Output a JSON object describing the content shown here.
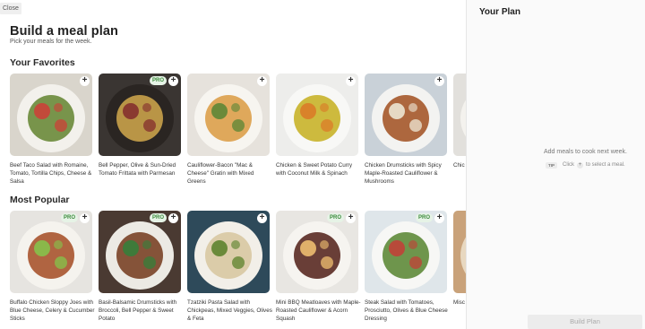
{
  "close_label": "Close",
  "header": {
    "title": "Build a meal plan",
    "subtitle": "Pick your meals for the week."
  },
  "sections": [
    {
      "title": "Your Favorites",
      "meals": [
        {
          "name": "Beef Taco Salad with Romaine, Tomato, Tortilla Chips, Cheese & Salsa",
          "pro": false,
          "bg": "#d9d5cc",
          "plate": "#f3f1ec",
          "food": "#6a8a3a",
          "food2": "#c24a3a"
        },
        {
          "name": "Bell Pepper, Olive & Sun-Dried Tomato Frittata with Parmesan",
          "pro": true,
          "bg": "#3a3532",
          "plate": "#2a2522",
          "food": "#c9a24a",
          "food2": "#8a3a30"
        },
        {
          "name": "Cauliflower-Bacon \"Mac & Cheese\" Gratin with Mixed Greens",
          "pro": false,
          "bg": "#e6e2dc",
          "plate": "#f7f5f0",
          "food": "#dba04a",
          "food2": "#6a8a3a"
        },
        {
          "name": "Chicken & Sweet Potato Curry with Coconut Milk & Spinach",
          "pro": false,
          "bg": "#ededeb",
          "plate": "#f8f8f6",
          "food": "#c8b22a",
          "food2": "#d9822a"
        },
        {
          "name": "Chicken Drumsticks with Spicy Maple-Roasted Cauliflower & Mushrooms",
          "pro": false,
          "bg": "#c9d1d8",
          "plate": "#f3f3f1",
          "food": "#a5582a",
          "food2": "#e6d9c4"
        },
        {
          "name": "Chic Bok",
          "pro": false,
          "bg": "#e2e0dc",
          "plate": "#f4f2ee",
          "food": "#8a6a3a",
          "food2": "#6a8a3a"
        }
      ]
    },
    {
      "title": "Most Popular",
      "meals": [
        {
          "name": "Buffalo Chicken Sloppy Joes with Blue Cheese, Celery & Cucumber Sticks",
          "pro": true,
          "bg": "#e6e4e0",
          "plate": "#f5f3ee",
          "food": "#a8542e",
          "food2": "#8ab84a"
        },
        {
          "name": "Basil-Balsamic Drumsticks with Broccoli, Bell Pepper & Sweet Potato",
          "pro": true,
          "bg": "#4a3a32",
          "plate": "#eceae4",
          "food": "#7a4226",
          "food2": "#3e7a3a"
        },
        {
          "name": "Tzatziki Pasta Salad with Chickpeas, Mixed Veggies, Olives & Feta",
          "pro": false,
          "bg": "#2e4a5a",
          "plate": "#f2efe8",
          "food": "#d8c8a2",
          "food2": "#6a8a3a"
        },
        {
          "name": "Mini BBQ Meatloaves with Maple-Roasted Cauliflower & Acorn Squash",
          "pro": true,
          "bg": "#e8e6e2",
          "plate": "#f6f4f0",
          "food": "#5a2a22",
          "food2": "#e0b06a"
        },
        {
          "name": "Steak Salad with Tomatoes, Prosciutto, Olives & Blue Cheese Dressing",
          "pro": true,
          "bg": "#dfe6ea",
          "plate": "#f7f7f5",
          "food": "#5e8a3a",
          "food2": "#b84a3a"
        },
        {
          "name": "Misc Turk Mus",
          "pro": false,
          "bg": "#c9a27a",
          "plate": "#e8d8c0",
          "food": "#8a5a32",
          "food2": "#5a7a3a"
        }
      ]
    }
  ],
  "panel": {
    "title": "Your Plan",
    "empty_message": "Add meals to cook next week.",
    "tip_badge": "TIP",
    "tip_before": "Click",
    "tip_plus": "+",
    "tip_after": "to select a meal.",
    "build_label": "Build Plan"
  },
  "icons": {
    "add": "+",
    "pro_label": "PRO"
  }
}
